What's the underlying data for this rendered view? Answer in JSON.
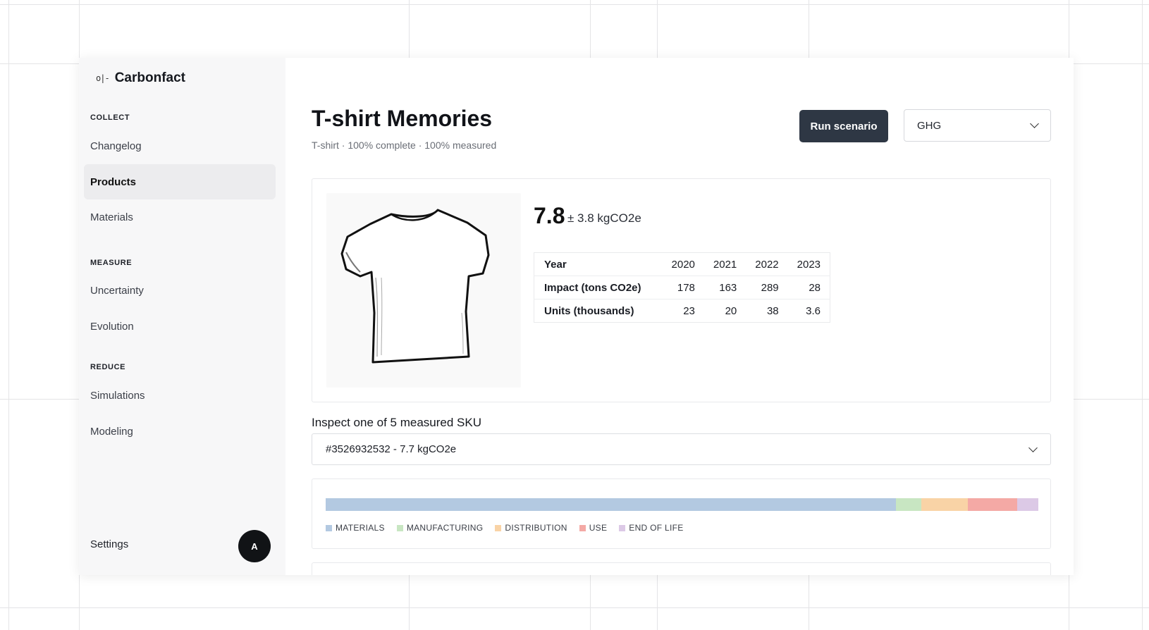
{
  "brand": {
    "logo": "o|-",
    "name": "Carbonfact"
  },
  "sidebar": {
    "sections": [
      {
        "title": "COLLECT",
        "items": [
          "Changelog",
          "Products",
          "Materials"
        ]
      },
      {
        "title": "MEASURE",
        "items": [
          "Uncertainty",
          "Evolution"
        ]
      },
      {
        "title": "REDUCE",
        "items": [
          "Simulations",
          "Modeling"
        ]
      }
    ],
    "active_item": "Products",
    "settings_label": "Settings",
    "avatar_initial": "A"
  },
  "header": {
    "title": "T-shirt Memories",
    "subtitle": "T-shirt · 100% complete · 100% measured",
    "run_button": "Run scenario",
    "metric_select": "GHG"
  },
  "product": {
    "value": "7.8",
    "value_unit": "± 3.8 kgCO2e",
    "table": {
      "header": [
        "Year",
        "2020",
        "2021",
        "2022",
        "2023"
      ],
      "rows": [
        [
          "Impact (tons CO2e)",
          "178",
          "163",
          "289",
          "28"
        ],
        [
          "Units (thousands)",
          "23",
          "20",
          "38",
          "3.6"
        ]
      ]
    }
  },
  "inspect": {
    "label": "Inspect one of 5 measured SKU",
    "selected": "#3526932532 - 7.7 kgCO2e"
  },
  "breakdown": {
    "segments": [
      {
        "label": "MATERIALS",
        "share": 0.8,
        "color": "#b3c9e1"
      },
      {
        "label": "MANUFACTURING",
        "share": 0.036,
        "color": "#c8e6c2"
      },
      {
        "label": "DISTRIBUTION",
        "share": 0.065,
        "color": "#f9d3a6"
      },
      {
        "label": "USE",
        "share": 0.069,
        "color": "#f4a9a5"
      },
      {
        "label": "END OF LIFE",
        "share": 0.03,
        "color": "#dcc9e6"
      }
    ]
  }
}
